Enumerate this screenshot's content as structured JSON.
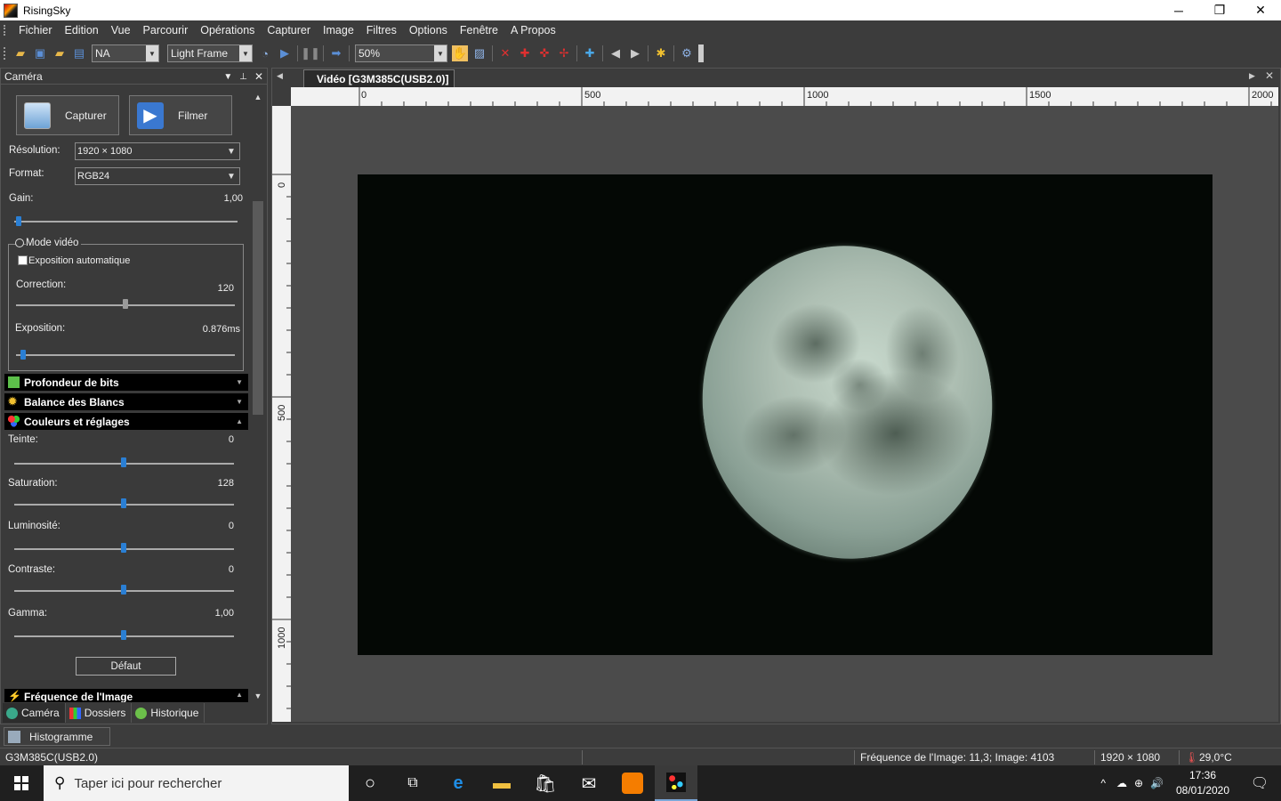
{
  "window": {
    "title": "RisingSky",
    "minimize": "─",
    "restore": "❐",
    "close": "✕"
  },
  "menu": [
    "Fichier",
    "Edition",
    "Vue",
    "Parcourir",
    "Opérations",
    "Capturer",
    "Image",
    "Filtres",
    "Options",
    "Fenêtre",
    "A Propos"
  ],
  "toolbar": {
    "combo_na": "NA",
    "combo_frame": "Light Frame",
    "combo_zoom": "50%",
    "icons": [
      "open-icon",
      "save-icon",
      "folder-icon",
      "import-icon",
      "clock-icon",
      "play-step-icon",
      "pause-icon",
      "record-icon",
      "hand-icon",
      "fit-icon",
      "cross-red-icon",
      "cross-red-icon",
      "cross-red-icon",
      "cross-red-icon",
      "crosshair-blue-icon",
      "prev-icon",
      "next-icon",
      "stars-icon",
      "gear-icon"
    ]
  },
  "left_panel": {
    "title": "Caméra",
    "capture_label": "Capturer",
    "film_label": "Filmer",
    "resolution_label": "Résolution:",
    "resolution_value": "1920 × 1080",
    "format_label": "Format:",
    "format_value": "RGB24",
    "gain_label": "Gain:",
    "gain_value": "1,00",
    "gain_level": 0.01,
    "mode_video_label": "Mode vidéo",
    "auto_exposure_label": "Exposition automatique",
    "correction_label": "Correction:",
    "correction_value": "120",
    "correction_level": 0.5,
    "exposure_label": "Exposition:",
    "exposure_value": "0.876ms",
    "exposure_level": 0.02,
    "sections": {
      "bit_depth": "Profondeur de bits",
      "white_balance": "Balance des Blancs",
      "colors": "Couleurs et réglages",
      "frame_rate": "Fréquence de l'Image"
    },
    "teinte_label": "Teinte:",
    "teinte_value": "0",
    "saturation_label": "Saturation:",
    "saturation_value": "128",
    "luminosite_label": "Luminosité:",
    "luminosite_value": "0",
    "contraste_label": "Contraste:",
    "contraste_value": "0",
    "gamma_label": "Gamma:",
    "gamma_value": "1,00",
    "default_button": "Défaut",
    "tabs": [
      "Caméra",
      "Dossiers",
      "Historique"
    ],
    "histogram_tab": "Histogramme"
  },
  "document": {
    "tab_title": "Vidéo [G3M385C(USB2.0)]",
    "ruler_h": [
      "0",
      "500",
      "1000",
      "1500",
      "2000"
    ],
    "ruler_v": [
      "0",
      "500",
      "1000"
    ]
  },
  "status": {
    "camera": "G3M385C(USB2.0)",
    "frame_info": "Fréquence de l'Image: 11,3; Image: 4103",
    "resolution": "1920 × 1080",
    "temperature": "29,0°C"
  },
  "taskbar": {
    "search_placeholder": "Taper ici pour rechercher",
    "time": "17:36",
    "date": "08/01/2020"
  }
}
